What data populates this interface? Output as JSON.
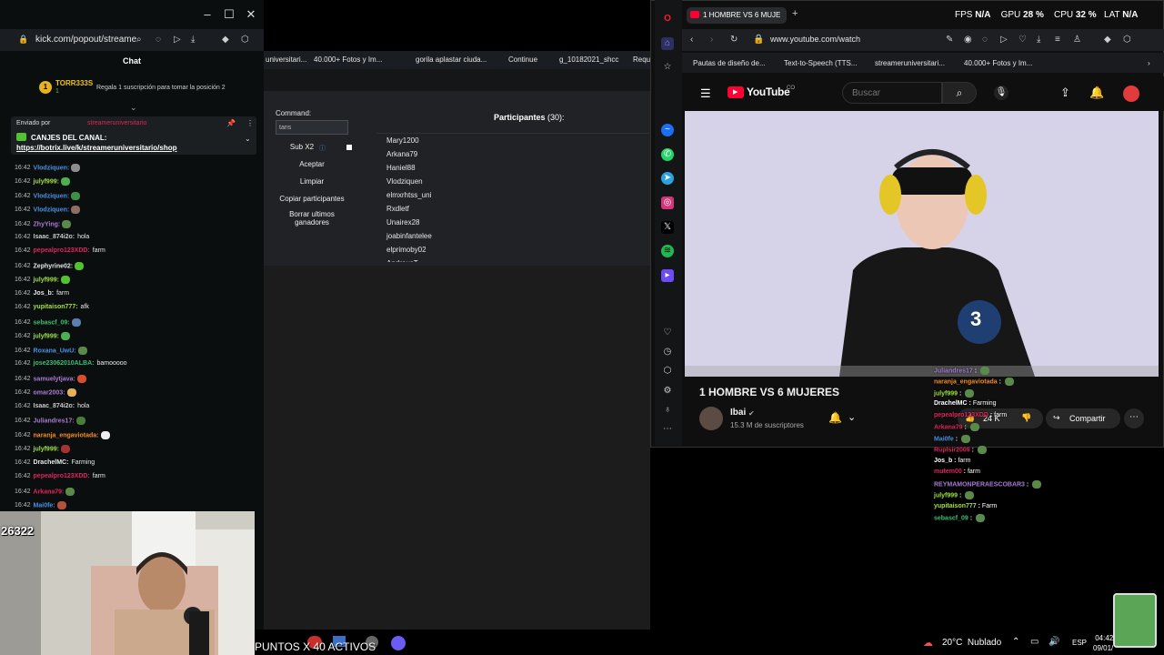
{
  "kick": {
    "url": "kick.com/popout/streame",
    "chat_title": "Chat",
    "top_gifter": {
      "rank": "1",
      "name": "TORR333S",
      "level": "1",
      "prompt": "Regala 1 suscripción para tomar la posición 2"
    },
    "pinned": {
      "sent_by": "Enviado por",
      "sender": "streameruniversitario",
      "title": "CANJES DEL CANAL:",
      "link": "https://botrix.live/k/streameruniversitario/shop"
    },
    "messages": [
      {
        "time": "16:42",
        "user": "Vlodziquen:",
        "text": "",
        "color": "#4a90e2",
        "emote": "#8e8e8e"
      },
      {
        "time": "16:42",
        "user": "julyf999:",
        "text": "",
        "color": "#a0e13f",
        "emote": "#4caf50"
      },
      {
        "time": "16:42",
        "user": "Vlodziquen:",
        "text": "",
        "color": "#4a90e2",
        "emote": "#3d8f45"
      },
      {
        "time": "16:42",
        "user": "Vlodziquen:",
        "text": "",
        "color": "#4a90e2",
        "emote": "#8d6e63"
      },
      {
        "time": "16:42",
        "user": "ZhyYing:",
        "text": "",
        "color": "#a77bd1",
        "emote": "#5a8a4a"
      },
      {
        "time": "16:42",
        "user": "Isaac_874i2o:",
        "text": "hola",
        "color": "#c9c9c9",
        "emote": ""
      },
      {
        "time": "16:42",
        "user": "pepealpro123XDD:",
        "text": "farm",
        "color": "#e0245e",
        "emote": ""
      },
      {
        "time": "16:42",
        "user": "Zephyrine02:",
        "text": "",
        "color": "#e8e8e8",
        "emote": "#53c130"
      },
      {
        "time": "16:42",
        "user": "julyf999:",
        "text": "",
        "color": "#a0e13f",
        "emote": "#53c130"
      },
      {
        "time": "16:42",
        "user": "Jos_b:",
        "text": "farm",
        "color": "#e8e8e8",
        "emote": ""
      },
      {
        "time": "16:42",
        "user": "yupitaison777:",
        "text": "afk",
        "color": "#a0e13f",
        "emote": ""
      },
      {
        "time": "16:42",
        "user": "sebascf_09:",
        "text": "",
        "color": "#38c172",
        "emote": "#5a7fb0"
      },
      {
        "time": "16:42",
        "user": "julyf999:",
        "text": "",
        "color": "#a0e13f",
        "emote": "#4caf50"
      },
      {
        "time": "16:42",
        "user": "Roxana_UwU:",
        "text": "",
        "color": "#4a90e2",
        "emote": "#5a8a4a"
      },
      {
        "time": "16:42",
        "user": "jose23062010ALBA:",
        "text": "bamooooo",
        "color": "#38c172",
        "emote": ""
      },
      {
        "time": "16:42",
        "user": "samuelytjava:",
        "text": "",
        "color": "#a77bd1",
        "emote": "#d84c2f"
      },
      {
        "time": "16:42",
        "user": "omar2003:",
        "text": "",
        "color": "#a77bd1",
        "emote": "#e2b25a"
      },
      {
        "time": "16:42",
        "user": "Isaac_874i2o:",
        "text": "hola",
        "color": "#c9c9c9",
        "emote": ""
      },
      {
        "time": "16:42",
        "user": "Juliandres17:",
        "text": "",
        "color": "#a77bd1",
        "emote": "#4a7d3a"
      },
      {
        "time": "16:42",
        "user": "naranja_engaviotada:",
        "text": "",
        "color": "#f28c28",
        "emote": "#eeeeee"
      },
      {
        "time": "16:42",
        "user": "julyf999:",
        "text": "",
        "color": "#a0e13f",
        "emote": "#a83232"
      },
      {
        "time": "16:42",
        "user": "DrachelMC:",
        "text": "Farming",
        "color": "#e8e8e8",
        "emote": ""
      },
      {
        "time": "16:42",
        "user": "pepealpro123XDD:",
        "text": "farm",
        "color": "#e0245e",
        "emote": ""
      },
      {
        "time": "16:42",
        "user": "Arkana79:",
        "text": "",
        "color": "#e0245e",
        "emote": "#5a8a4a"
      },
      {
        "time": "16:42",
        "user": "Mai0fe:",
        "text": "",
        "color": "#4a90e2",
        "emote": "#b5523b"
      }
    ],
    "cam_counter": "26322"
  },
  "tool": {
    "bookmarks": [
      "universitari...",
      "40.000+ Fotos y Im...",
      "gorila aplastar ciuda...",
      "Continue",
      "g_10182021_shcc",
      "Requ"
    ],
    "command_label": "Command:",
    "command_value": "taris",
    "buttons": [
      "Sub X2",
      "Aceptar",
      "Limpiar",
      "Copiar participantes",
      "Borrar ultimos ganadores"
    ],
    "participants_title": "Participantes",
    "participants_count": "(30):",
    "participants": [
      "Mary1200",
      "Arkana79",
      "Haniel88",
      "Vlodziquen",
      "elmxrhtss_uni",
      "Rxdletf",
      "Unairex28",
      "joabinfantelee",
      "elprimoby02",
      "AndreusT"
    ]
  },
  "browser": {
    "tab_title": "1 HOMBRE VS 6 MUJE",
    "url": "www.youtube.com/watch",
    "bookmarks": [
      "Pautas de diseño de...",
      "Text-to-Speech (TTS...",
      "streameruniversitari...",
      "40.000+ Fotos y Im..."
    ]
  },
  "stats": {
    "fps_label": "FPS",
    "fps_value": "N/A",
    "gpu_label": "GPU",
    "gpu_value": "28 %",
    "cpu_label": "CPU",
    "cpu_value": "32 %",
    "lat_label": "LAT",
    "lat_value": "N/A"
  },
  "youtube": {
    "logo": "YouTube",
    "country": "CO",
    "search_placeholder": "Buscar",
    "video_title": "1 HOMBRE VS 6 MUJERES",
    "channel": "Ibai",
    "subscribers": "15.3 M de suscriptores",
    "likes": "24 K",
    "share": "Compartir",
    "bib_number": "3"
  },
  "overlay_chat": [
    {
      "user": "Juliandres17",
      "text": "",
      "color": "#a77bd1"
    },
    {
      "user": "naranja_engaviotada",
      "text": "",
      "color": "#f28c28"
    },
    {
      "user": "julyf999",
      "text": "",
      "color": "#a0e13f"
    },
    {
      "user": "DrachelMC",
      "text": "Farming",
      "color": "#ffffff"
    },
    {
      "user": "pepealpro123XDD",
      "text": "farm",
      "color": "#e0245e"
    },
    {
      "user": "Arkana79",
      "text": "",
      "color": "#e0245e"
    },
    {
      "user": "Mai0fe",
      "text": "",
      "color": "#4a90e2"
    },
    {
      "user": "Ruplsir2009",
      "text": "",
      "color": "#e0245e"
    },
    {
      "user": "Jos_b",
      "text": "farm",
      "color": "#ffffff"
    },
    {
      "user": "mutem00",
      "text": "farm",
      "color": "#e0245e"
    },
    {
      "user": "REYMAMONPERAESCOBAR3",
      "text": "",
      "color": "#a77bd1"
    },
    {
      "user": "julyf999",
      "text": "",
      "color": "#a0e13f"
    },
    {
      "user": "yupitaison777",
      "text": "Farm",
      "color": "#a0e13f"
    },
    {
      "user": "sebascf_09",
      "text": "",
      "color": "#38c172"
    }
  ],
  "taskbar": {
    "points": "PUNTOS X 40 ACTIVOS",
    "temp": "20°C",
    "weather": "Nublado",
    "lang": "ESP",
    "time": "04:42",
    "date": "09/01/"
  }
}
